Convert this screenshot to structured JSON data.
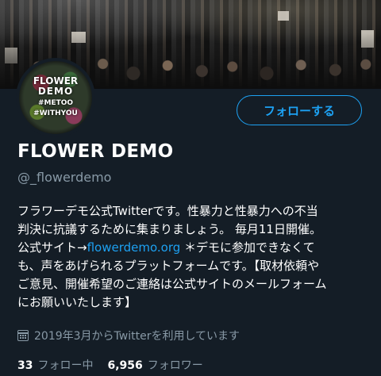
{
  "profile": {
    "avatar_text": [
      "FLOWER",
      "DEMO",
      "#METOO",
      "#WITHYOU"
    ],
    "name": "FLOWER DEMO",
    "handle": "@_flowerdemo",
    "follow_label": "フォローする",
    "bio": {
      "line1": "フラワーデモ公式Twitterです。性暴力と性暴力への不当",
      "line2": "判決に抗議するために集まりましょう。 毎月11日開催。",
      "line3_prefix": "公式サイト→",
      "line3_link": "flowerdemo.org",
      "line3_suffix": " ＊デモに参加できなくて",
      "line4": "も、声をあげられるプラットフォームです。【取材依頼や",
      "line5": "ご意見、開催希望のご連絡は公式サイトのメールフォーム",
      "line6": "にお願いいたします】"
    },
    "joined": "2019年3月からTwitterを利用しています",
    "stats": {
      "following_count": "33",
      "following_label": "フォロー中",
      "followers_count": "6,956",
      "followers_label": "フォロワー"
    }
  },
  "colors": {
    "background": "#141d26",
    "accent": "#1da1f2",
    "secondary_text": "#8899a6"
  },
  "icons": {
    "joined": "calendar-icon"
  }
}
